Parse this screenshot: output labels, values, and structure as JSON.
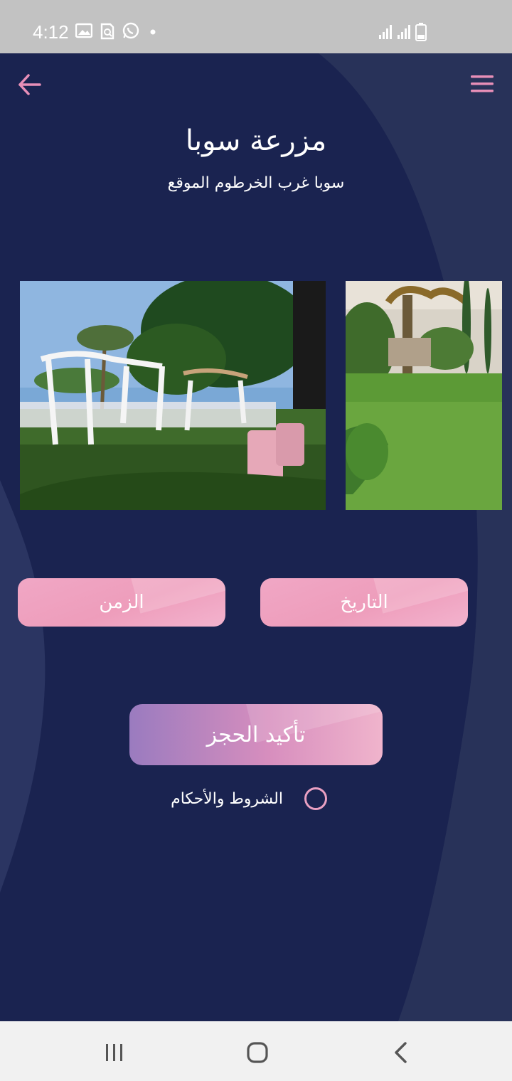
{
  "status_bar": {
    "time": "4:12",
    "icons": [
      "image-icon",
      "search-doc-icon",
      "whatsapp-icon",
      "dot-icon"
    ],
    "right_icons": [
      "signal-icon",
      "signal-icon",
      "battery-icon"
    ]
  },
  "header": {
    "back_icon": "arrow-left-icon",
    "menu_icon": "hamburger-menu-icon"
  },
  "venue": {
    "title": "مزرعة سوبا",
    "subtitle": "سوبا غرب الخرطوم الموقع"
  },
  "gallery": {
    "images": [
      "wedding-setup-photo",
      "garden-lawn-photo"
    ]
  },
  "buttons": {
    "time_label": "الزمن",
    "date_label": "التاريخ",
    "confirm_label": "تأكيد الحجز"
  },
  "terms": {
    "label": "الشروط والأحكام",
    "checked": false
  },
  "nav": {
    "items": [
      "recent-apps-icon",
      "home-icon",
      "back-icon"
    ]
  },
  "colors": {
    "background": "#1a2350",
    "accent_pink": "#ee9dbb",
    "accent_purple": "#9a7bbf"
  }
}
